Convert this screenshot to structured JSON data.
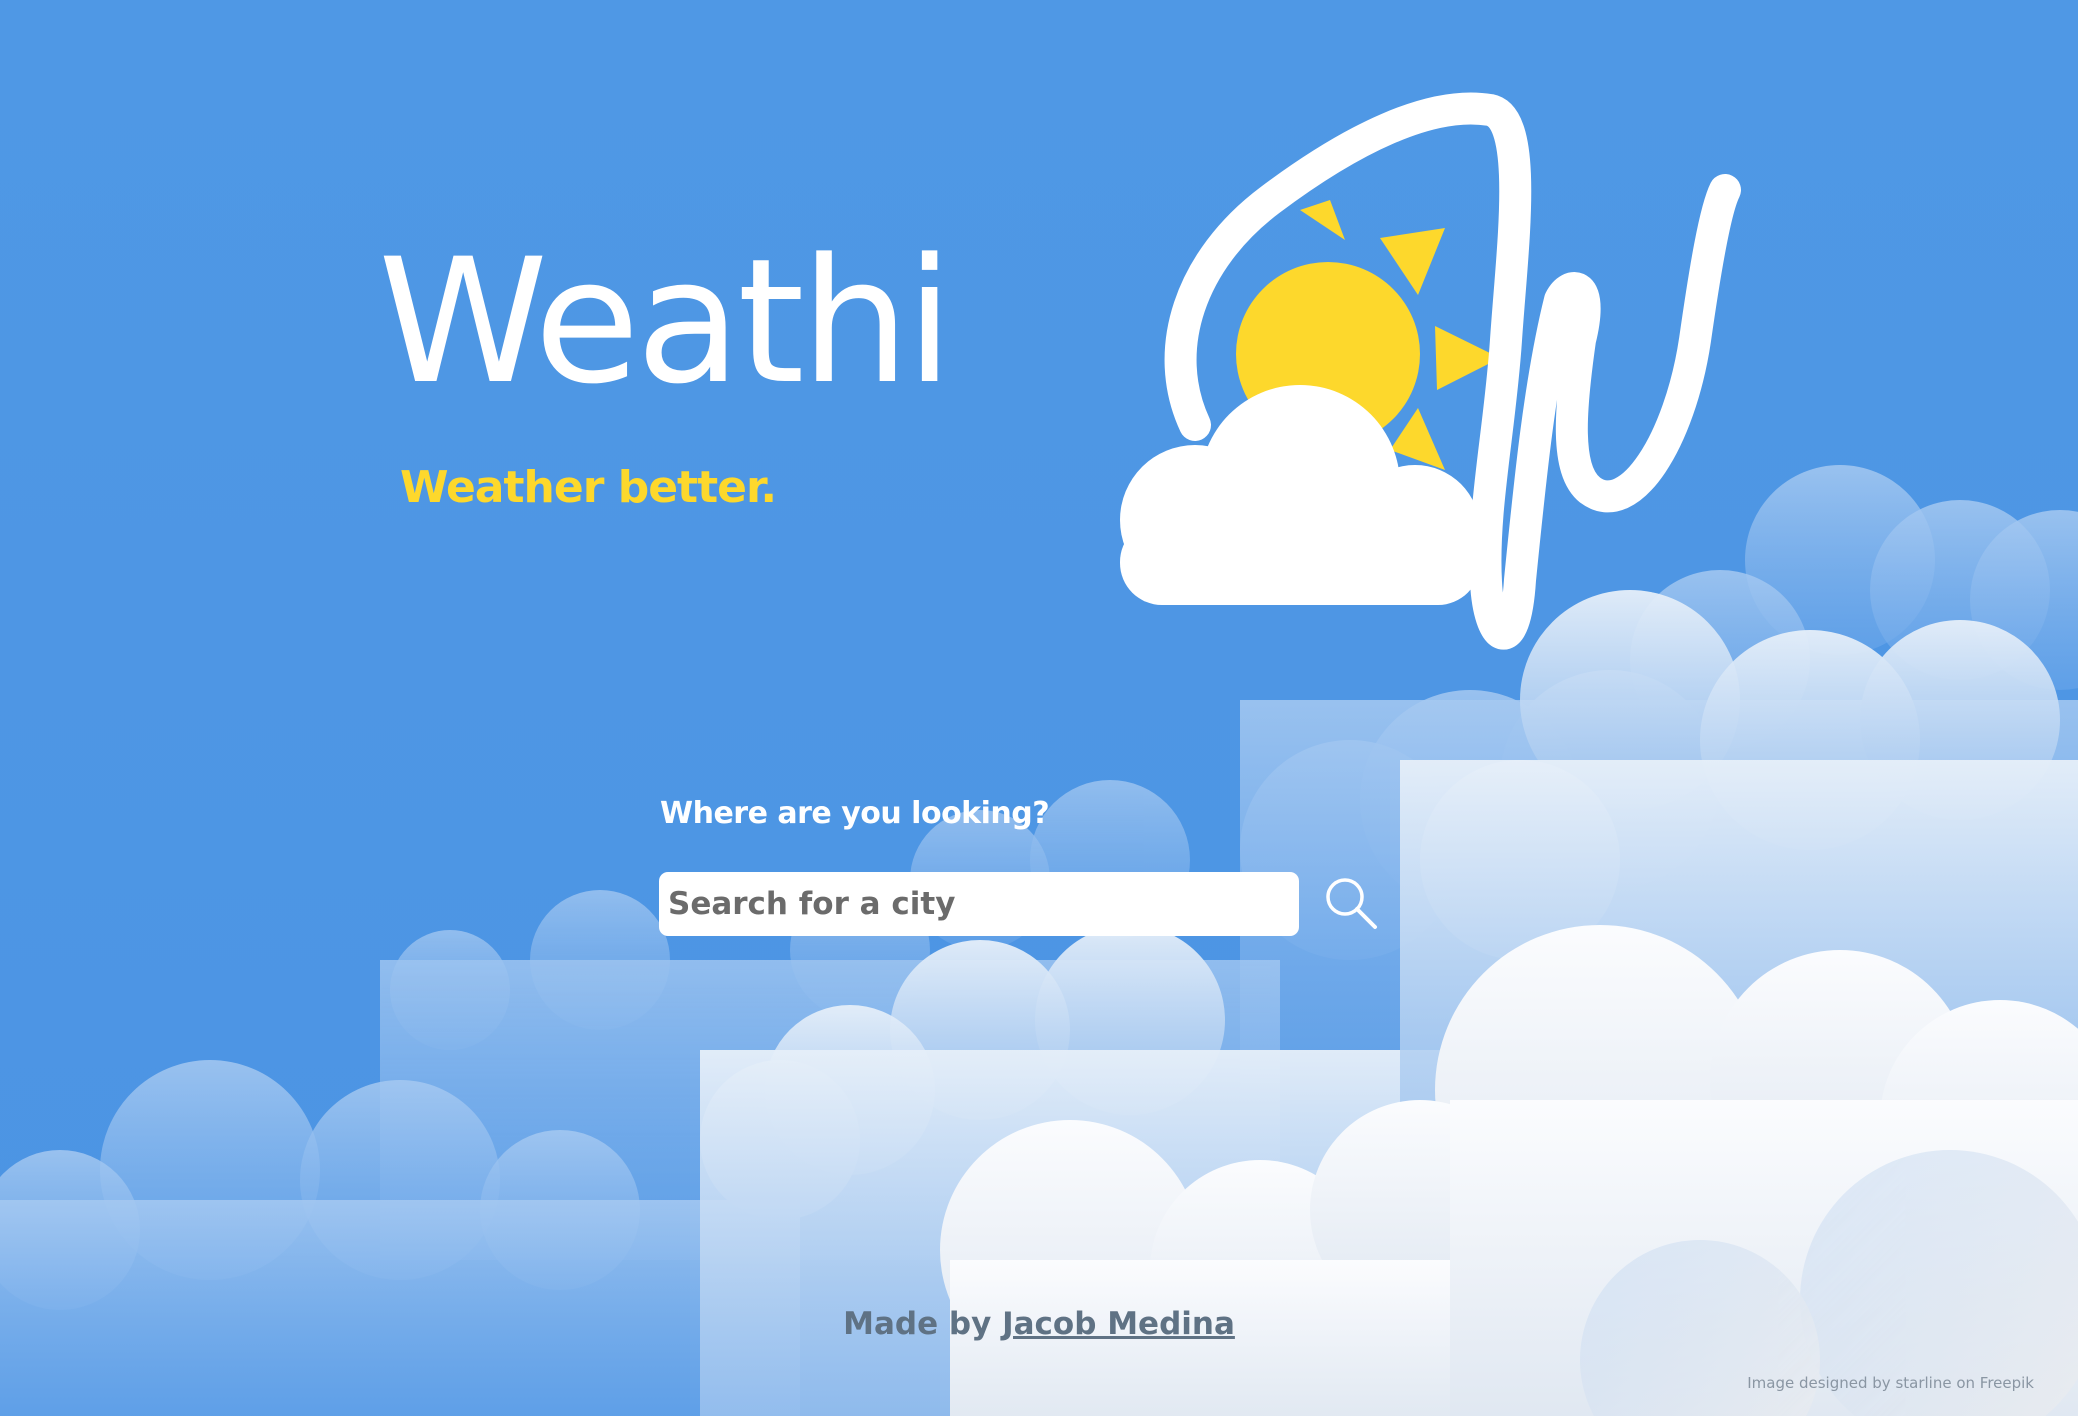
{
  "app": {
    "title": "Weathi",
    "tagline": "Weather better."
  },
  "search": {
    "label": "Where are you looking?",
    "placeholder": "Search for a city",
    "value": "",
    "button_icon": "search-icon"
  },
  "footer": {
    "made_by_prefix": "Made by",
    "author_link_text": "Jacob Medina"
  },
  "image_credit": "Image designed by starline on Freepik",
  "logo": {
    "icon": "sun-behind-cloud-icon",
    "letter_icon": "script-w-icon"
  },
  "colors": {
    "sky": "#4f98e5",
    "tagline": "#fdd82c",
    "sun": "#fdd82c",
    "cloud": "#ffffff",
    "footer_text": "#5f7284",
    "input_text": "#6b6b6b"
  }
}
